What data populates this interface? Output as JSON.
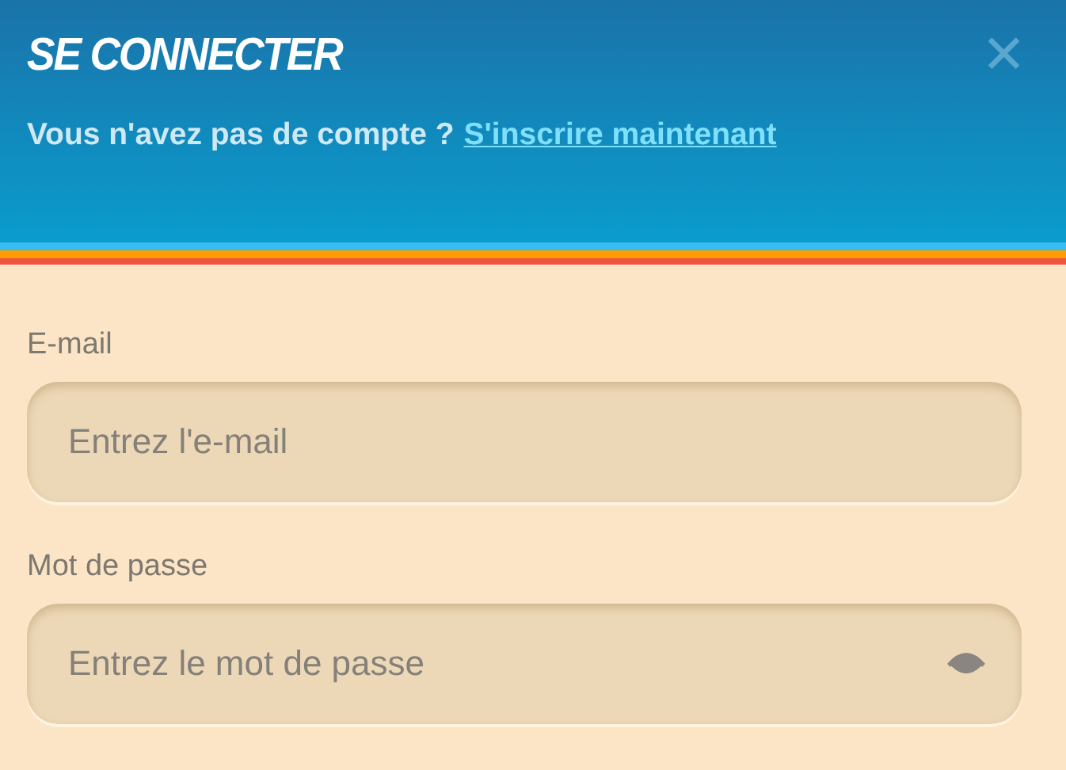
{
  "header": {
    "title": "SE CONNECTER",
    "close": "✕",
    "prompt": "Vous n'avez pas de compte ?",
    "signup_link": "S'inscrire maintenant"
  },
  "fields": [
    {
      "kind": "text",
      "label": "E-mail",
      "placeholder": "Entrez l'e-mail"
    },
    {
      "kind": "password",
      "label": "Mot de passe",
      "placeholder": "Entrez le mot de passe"
    }
  ]
}
